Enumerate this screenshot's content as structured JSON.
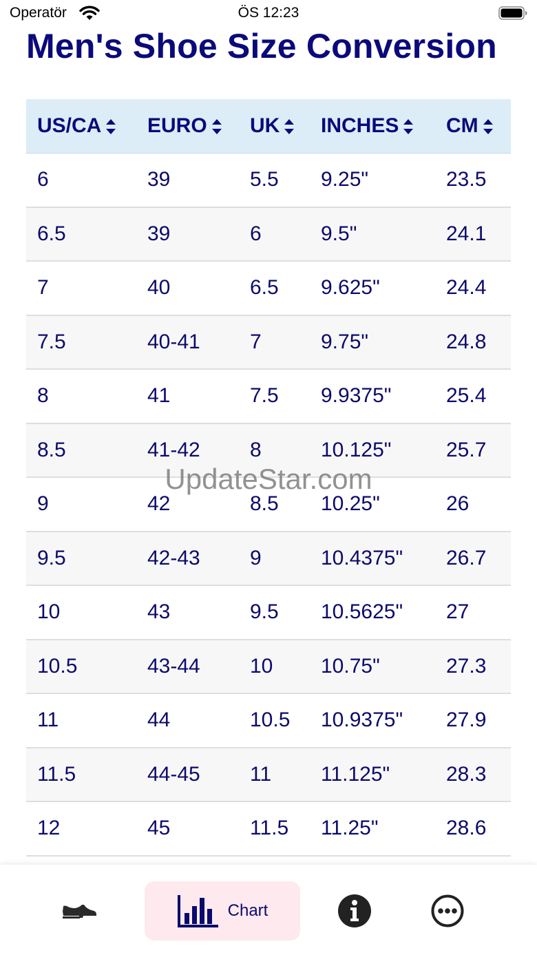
{
  "status_bar": {
    "carrier": "Operatör",
    "time": "ÖS 12:23"
  },
  "title": "Men's Shoe Size Conversion",
  "table": {
    "columns": [
      "US/CA",
      "EURO",
      "UK",
      "INCHES",
      "CM"
    ],
    "rows": [
      [
        "6",
        "39",
        "5.5",
        "9.25\"",
        "23.5"
      ],
      [
        "6.5",
        "39",
        "6",
        "9.5\"",
        "24.1"
      ],
      [
        "7",
        "40",
        "6.5",
        "9.625\"",
        "24.4"
      ],
      [
        "7.5",
        "40-41",
        "7",
        "9.75\"",
        "24.8"
      ],
      [
        "8",
        "41",
        "7.5",
        "9.9375\"",
        "25.4"
      ],
      [
        "8.5",
        "41-42",
        "8",
        "10.125\"",
        "25.7"
      ],
      [
        "9",
        "42",
        "8.5",
        "10.25\"",
        "26"
      ],
      [
        "9.5",
        "42-43",
        "9",
        "10.4375\"",
        "26.7"
      ],
      [
        "10",
        "43",
        "9.5",
        "10.5625\"",
        "27"
      ],
      [
        "10.5",
        "43-44",
        "10",
        "10.75\"",
        "27.3"
      ],
      [
        "11",
        "44",
        "10.5",
        "10.9375\"",
        "27.9"
      ],
      [
        "11.5",
        "44-45",
        "11",
        "11.125\"",
        "28.3"
      ],
      [
        "12",
        "45",
        "11.5",
        "11.25\"",
        "28.6"
      ]
    ]
  },
  "watermark": "UpdateStar.com",
  "tab_bar": {
    "active": "chart",
    "chart_label": "Chart",
    "icons": [
      "shoe-icon",
      "bar-chart-icon",
      "info-icon",
      "more-icon"
    ]
  }
}
